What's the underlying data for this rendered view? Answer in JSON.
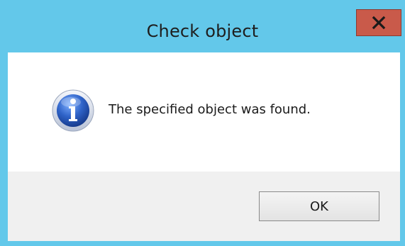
{
  "window": {
    "title": "Check object"
  },
  "titlebar": {
    "close_label": "X"
  },
  "message": {
    "text": "The specified object was found.",
    "icon": "info-icon"
  },
  "buttons": {
    "ok_label": "OK"
  },
  "colors": {
    "titlebar": "#63c8ea",
    "close_button": "#c95a4a",
    "footer": "#f0f0f0",
    "icon_blue": "#2a5ab8"
  }
}
